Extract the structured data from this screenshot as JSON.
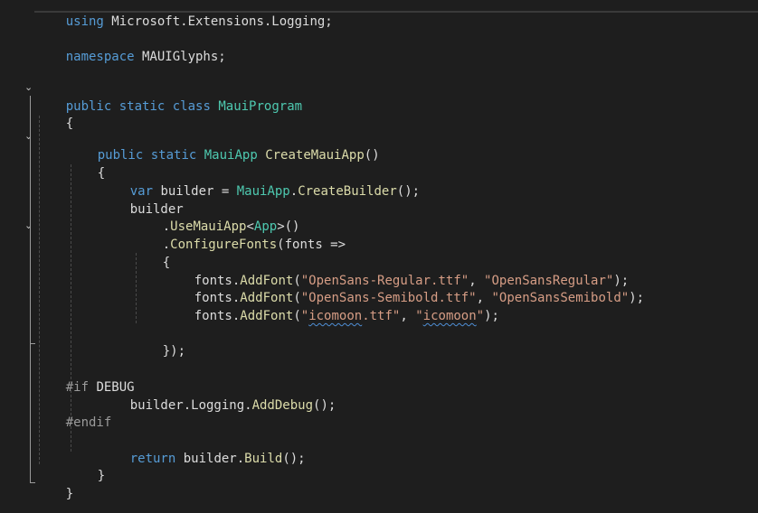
{
  "editor": {
    "lines": {
      "l1": [
        "using",
        " Microsoft.Extensions.Logging;"
      ],
      "l3": [
        "namespace",
        " MAUIGlyphs;"
      ],
      "l6": [
        "public",
        " ",
        "static",
        " ",
        "class",
        " ",
        "MauiProgram"
      ],
      "l7": "{",
      "l9": [
        "public",
        " ",
        "static",
        " ",
        "MauiApp",
        " ",
        "CreateMauiApp",
        "()"
      ],
      "l10": "{",
      "l11": [
        "var",
        " builder = ",
        "MauiApp",
        ".",
        "CreateBuilder",
        "();"
      ],
      "l12": "builder",
      "l13": [
        ".",
        "UseMauiApp",
        "<",
        "App",
        ">()"
      ],
      "l14": [
        ".",
        "ConfigureFonts",
        "(fonts =>"
      ],
      "l15": "{",
      "l16": [
        "fonts.",
        "AddFont",
        "(",
        "\"OpenSans-Regular.ttf\"",
        ", ",
        "\"OpenSansRegular\"",
        ");"
      ],
      "l17": [
        "fonts.",
        "AddFont",
        "(",
        "\"OpenSans-Semibold.ttf\"",
        ", ",
        "\"OpenSansSemibold\"",
        ");"
      ],
      "l18": [
        "fonts.",
        "AddFont",
        "(",
        "\"",
        "icomoon",
        ".ttf\"",
        ", ",
        "\"",
        "icomoon",
        "\"",
        ");"
      ],
      "l20": "});",
      "l22": [
        "#if",
        " ",
        "DEBUG"
      ],
      "l23": [
        "builder.Logging.",
        "AddDebug",
        "();"
      ],
      "l24": "#endif",
      "l26": [
        "return",
        " builder.",
        "Build",
        "();"
      ],
      "l27": "}",
      "l28": "}"
    },
    "fold_glyph": "⌄"
  }
}
